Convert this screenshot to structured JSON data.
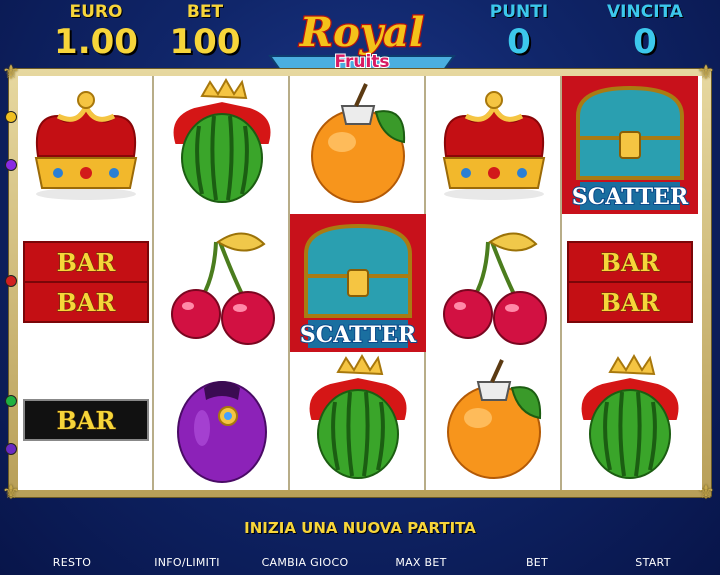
{
  "header": {
    "euro": {
      "label": "EURO",
      "value": "1.00"
    },
    "bet": {
      "label": "BET",
      "value": "100"
    },
    "punti": {
      "label": "PUNTI",
      "value": "0"
    },
    "vincita": {
      "label": "VINCITA",
      "value": "0"
    }
  },
  "logo": {
    "line1": "Royal",
    "line2": "Fruits"
  },
  "reels": [
    [
      "crown",
      "bar-bar",
      "bar"
    ],
    [
      "watermelon-king",
      "cherries",
      "plum"
    ],
    [
      "orange",
      "scatter",
      "watermelon-king"
    ],
    [
      "crown",
      "cherries",
      "orange"
    ],
    [
      "scatter",
      "bar-bar",
      "watermelon-king"
    ]
  ],
  "symbol_text": {
    "bar": "BAR",
    "scatter": "SCATTER"
  },
  "colors": {
    "gold": "#f7d53a",
    "cyan": "#3cc8ec",
    "red": "#c40f14",
    "navy": "#10266a"
  },
  "status_message": "INIZIA UNA NUOVA PARTITA",
  "buttons": {
    "resto": "RESTO",
    "info": "INFO/LIMITI",
    "cambia": "CAMBIA GIOCO",
    "maxbet": "MAX BET",
    "bet": "BET",
    "start": "START"
  }
}
